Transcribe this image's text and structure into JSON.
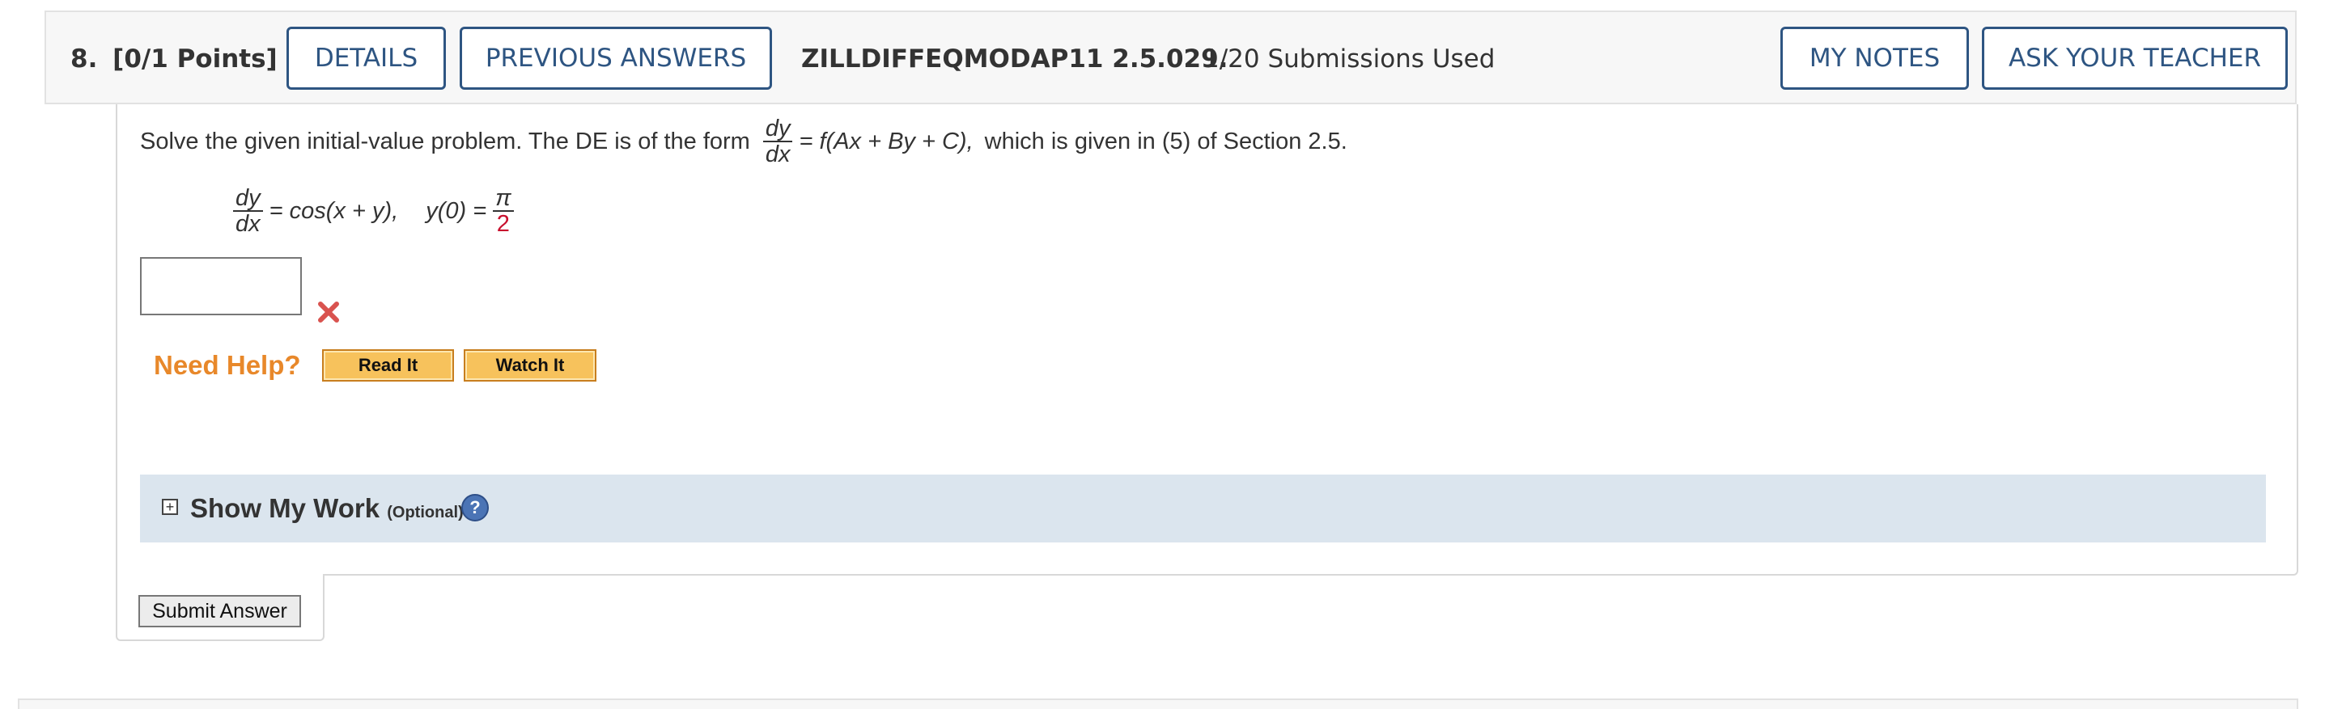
{
  "header": {
    "question_number": "8.",
    "points": "[0/1 Points]",
    "details_label": "DETAILS",
    "previous_answers_label": "PREVIOUS ANSWERS",
    "question_code": "ZILLDIFFEQMODAP11 2.5.029.",
    "submissions": "1/20 Submissions Used",
    "my_notes_label": "MY NOTES",
    "ask_teacher_label": "ASK YOUR TEACHER"
  },
  "problem": {
    "intro": "Solve the given initial-value problem. The DE is of the form",
    "form_num": "dy",
    "form_den": "dx",
    "form_rhs": "= f(Ax + By + C),",
    "outro": "which is given in (5) of Section 2.5.",
    "eq_num": "dy",
    "eq_den": "dx",
    "eq_rhs": "= cos(x + y),",
    "ic_lhs": "y(0) =",
    "ic_num": "π",
    "ic_den": "2"
  },
  "answer": {
    "value": "",
    "status": "incorrect"
  },
  "help": {
    "need_help_label": "Need Help?",
    "read_it_label": "Read It",
    "watch_it_label": "Watch It"
  },
  "show_my_work": {
    "toggle_symbol": "+",
    "title": "Show My Work",
    "optional": "(Optional)",
    "help_symbol": "?"
  },
  "submit_label": "Submit Answer",
  "colors": {
    "accent": "#2e5582",
    "error": "#d9534f",
    "need_help": "#e8882a",
    "help_button": "#f7c25c",
    "show_work_bg": "#dbe5ee"
  }
}
